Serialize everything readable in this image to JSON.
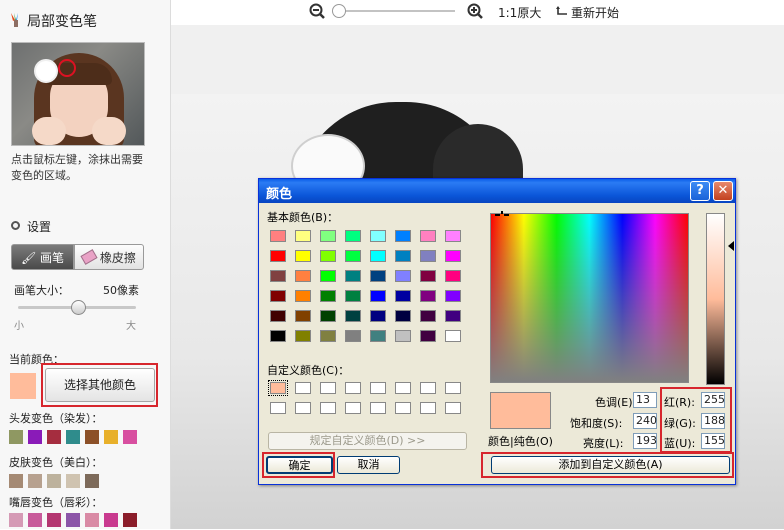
{
  "panel": {
    "title": "局部变色笔",
    "hint": "点击鼠标左键，涂抹出需要变色的区域。",
    "settings_label": "设置",
    "tool_brush": "画笔",
    "tool_eraser": "橡皮擦",
    "brush_size_label": "画笔大小：",
    "brush_size_value": "50像素",
    "slider_min": "小",
    "slider_max": "大",
    "brush_size_fraction": 0.5,
    "current_color_label": "当前颜色：",
    "current_color": "#ffbc9b",
    "other_color_button": "选择其他颜色",
    "hair_label": "头发变色（染发）：",
    "hair_colors": [
      "#8f9862",
      "#8a1bb8",
      "#a52d3f",
      "#2f8c8c",
      "#8c5028",
      "#e8b02a",
      "#d84fa0"
    ],
    "skin_label": "皮肤变色（美白）：",
    "skin_colors": [
      "#a58a74",
      "#b7a18f",
      "#bdb29d",
      "#cfc3b0",
      "#7d6a5a"
    ],
    "lips_label": "嘴唇变色（唇彩）：",
    "lip_colors": [
      "#d59ab5",
      "#c85a9a",
      "#b43670",
      "#8c55a8",
      "#d98aa5",
      "#c93a8f",
      "#8b1d2a"
    ]
  },
  "toolbar": {
    "zoom_fraction": 0.0,
    "original_size_label": "1:1原大",
    "restart_label": "重新开始"
  },
  "dialog": {
    "title": "颜色",
    "help_glyph": "?",
    "close_glyph": "✕",
    "basic_colors_label": "基本颜色(B)：",
    "basic_colors": [
      [
        "#ff8080",
        "#ffff80",
        "#80ff80",
        "#00ff80",
        "#80ffff",
        "#0080ff",
        "#ff80c0",
        "#ff80ff"
      ],
      [
        "#ff0000",
        "#ffff00",
        "#80ff00",
        "#00ff40",
        "#00ffff",
        "#0080c0",
        "#8080c0",
        "#ff00ff"
      ],
      [
        "#804040",
        "#ff8040",
        "#00ff00",
        "#008080",
        "#004080",
        "#8080ff",
        "#800040",
        "#ff0080"
      ],
      [
        "#800000",
        "#ff8000",
        "#008000",
        "#008040",
        "#0000ff",
        "#0000a0",
        "#800080",
        "#8000ff"
      ],
      [
        "#400000",
        "#804000",
        "#004000",
        "#004040",
        "#000080",
        "#000040",
        "#400040",
        "#400080"
      ],
      [
        "#000000",
        "#808000",
        "#808040",
        "#808080",
        "#408080",
        "#c0c0c0",
        "#400040",
        "#ffffff"
      ]
    ],
    "custom_colors_label": "自定义颜色(C)：",
    "custom_colors": [
      "#ffbc9b",
      "#ffffff",
      "#ffffff",
      "#ffffff",
      "#ffffff",
      "#ffffff",
      "#ffffff",
      "#ffffff",
      "#ffffff",
      "#ffffff",
      "#ffffff",
      "#ffffff",
      "#ffffff",
      "#ffffff",
      "#ffffff",
      "#ffffff"
    ],
    "define_custom_button": "规定自定义颜色(D) >>",
    "ok_button": "确定",
    "cancel_button": "取消",
    "color_solid_label": "颜色|纯色(O)",
    "hue_label": "色调(E):",
    "hue_value": "13",
    "sat_label": "饱和度(S):",
    "sat_value": "240",
    "lum_label": "亮度(L):",
    "lum_value": "193",
    "red_label": "红(R):",
    "red_value": "255",
    "green_label": "绿(G):",
    "green_value": "188",
    "blue_label": "蓝(U):",
    "blue_value": "155",
    "add_custom_button": "添加到自定义颜色(A)",
    "preview_color": "#ffbc9b"
  }
}
